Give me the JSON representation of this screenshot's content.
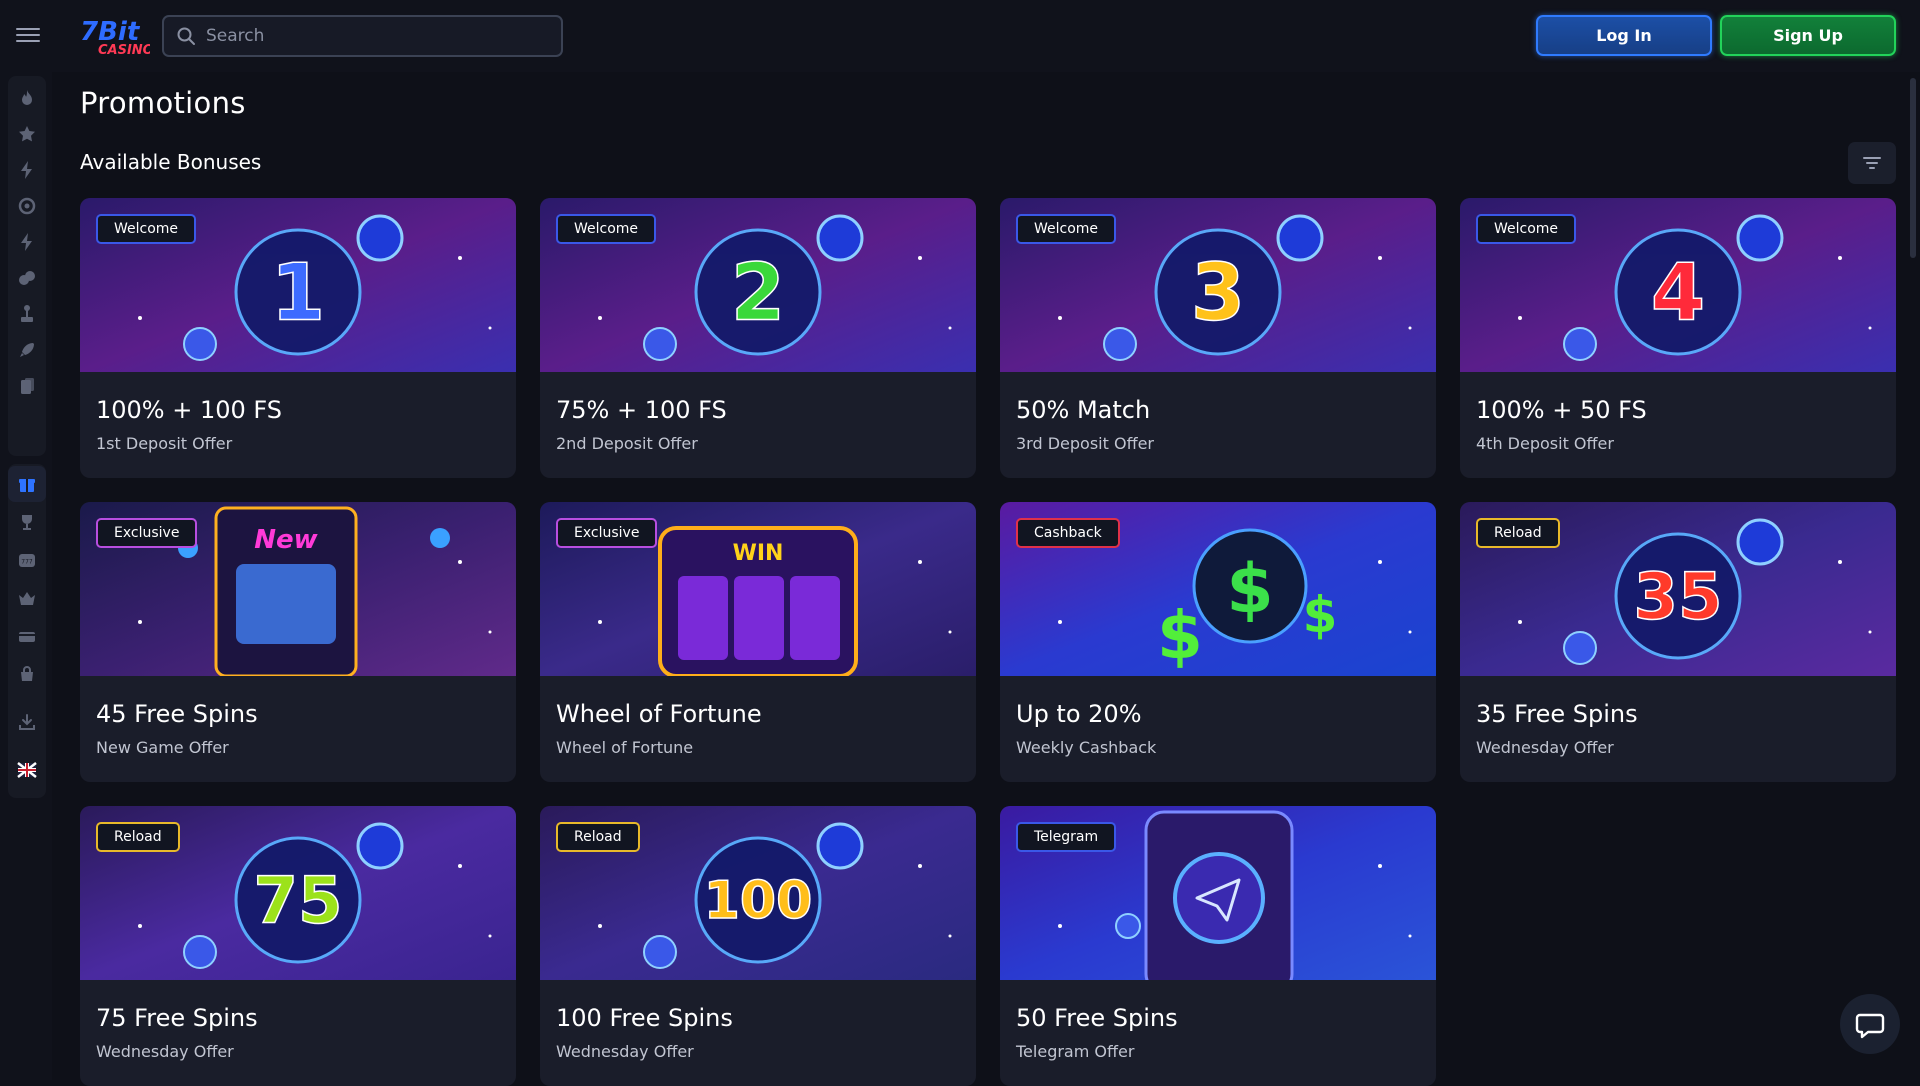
{
  "header": {
    "menu_icon": "hamburger-icon",
    "logo_text_top": "7Bit",
    "logo_text_bottom": "CASINO",
    "search_placeholder": "Search",
    "search_icon": "search-icon",
    "login_label": "Log In",
    "signup_label": "Sign Up"
  },
  "sidebar": {
    "icons": [
      "fire-icon",
      "star-icon",
      "lightning-icon",
      "target-icon",
      "lightning-icon",
      "dice-icon",
      "joystick-icon",
      "rocket-icon",
      "cards-icon",
      "gift-icon",
      "trophy-icon",
      "slot-777-icon",
      "crown-icon",
      "wallet-icon",
      "bag-icon",
      "download-icon",
      "language-flag-uk"
    ],
    "active": "gift-icon"
  },
  "page": {
    "title": "Promotions",
    "section_title": "Available Bonuses",
    "filter_icon": "filter-icon"
  },
  "cards": [
    {
      "badge": "Welcome",
      "badge_color": "#3a58e8",
      "title": "100% + 100 FS",
      "subtitle": "1st Deposit Offer",
      "art": "1"
    },
    {
      "badge": "Welcome",
      "badge_color": "#3a58e8",
      "title": "75% + 100 FS",
      "subtitle": "2nd Deposit Offer",
      "art": "2"
    },
    {
      "badge": "Welcome",
      "badge_color": "#3a58e8",
      "title": "50% Match",
      "subtitle": "3rd Deposit Offer",
      "art": "3"
    },
    {
      "badge": "Welcome",
      "badge_color": "#3a58e8",
      "title": "100% + 50 FS",
      "subtitle": "4th Deposit Offer",
      "art": "4"
    },
    {
      "badge": "Exclusive",
      "badge_color": "#b84ee0",
      "title": "45 Free Spins",
      "subtitle": "New Game Offer",
      "art": "New"
    },
    {
      "badge": "Exclusive",
      "badge_color": "#b84ee0",
      "title": "Wheel of Fortune",
      "subtitle": "Wheel of Fortune",
      "art": "WIN"
    },
    {
      "badge": "Cashback",
      "badge_color": "#e0314a",
      "title": "Up to 20%",
      "subtitle": "Weekly Cashback",
      "art": "$"
    },
    {
      "badge": "Reload",
      "badge_color": "#e8b92a",
      "title": "35 Free Spins",
      "subtitle": "Wednesday Offer",
      "art": "35"
    },
    {
      "badge": "Reload",
      "badge_color": "#e8b92a",
      "title": "75 Free Spins",
      "subtitle": "Wednesday Offer",
      "art": "75"
    },
    {
      "badge": "Reload",
      "badge_color": "#e8b92a",
      "title": "100 Free Spins",
      "subtitle": "Wednesday Offer",
      "art": "100"
    },
    {
      "badge": "Telegram",
      "badge_color": "#3a58e8",
      "title": "50 Free Spins",
      "subtitle": "Telegram Offer",
      "art": "telegram"
    }
  ],
  "chat_icon": "chat-bubble-icon",
  "colors": {
    "background": "#0e1018",
    "card": "#1a1d2a",
    "login_accent": "#2f7bff",
    "signup_accent": "#22d35a"
  }
}
